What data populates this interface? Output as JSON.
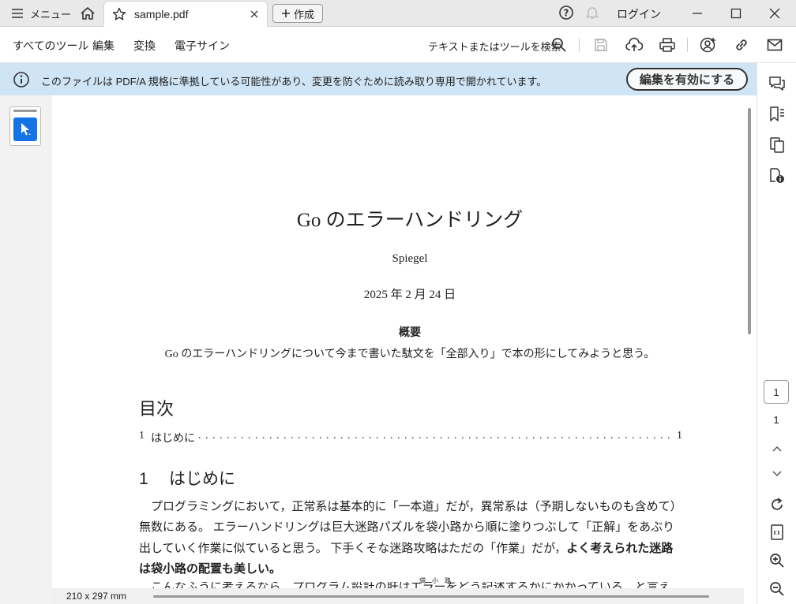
{
  "titlebar": {
    "menu_label": "メニュー",
    "tab_title": "sample.pdf",
    "create_label": "作成",
    "login_label": "ログイン"
  },
  "toolbar": {
    "menus": [
      "すべてのツール",
      "編集",
      "変換",
      "電子サイン"
    ],
    "search_label": "テキストまたはツールを検索"
  },
  "banner": {
    "text": "このファイルは PDF/A 規格に準拠している可能性があり、変更を防ぐために読み取り専用で開かれています。",
    "button_label": "編集を有効にする"
  },
  "document": {
    "title": "Go のエラーハンドリング",
    "author": "Spiegel",
    "date": "2025 年 2 月 24 日",
    "abstract_title": "概要",
    "abstract_text": "Go のエラーハンドリングについて今まで書いた駄文を「全部入り」で本の形にしてみようと思う。",
    "toc_title": "目次",
    "toc": [
      {
        "num": "1",
        "title": "はじめに",
        "page": "1"
      }
    ],
    "section": {
      "num": "1",
      "title": "はじめに"
    },
    "body_lines": [
      "　プログラミングにおいて，正常系は基本的に「一本道」だが，異常系は（予期しないものも含めて）",
      "無数にある。 エラーハンドリングは巨大迷路パズルを袋小路から順に塗りつぶして「正解」をあぶり",
      "出していく作業に似ていると思う。 下手くそな迷路攻略はただの「作業」だが，"
    ],
    "body_bold_a": "よく考えられた迷路",
    "body_bold_b": "は袋小路の配置も美しい。",
    "cut_text": "　こんなふうに考えるなら，プログラム設計の肝はエラーをどう記述するかにかかっている，と言え",
    "ruby": "袋　小　路"
  },
  "statusbar": {
    "page_size": "210 x 297 mm"
  },
  "pagination": {
    "current": "1",
    "total": "1"
  },
  "colors": {
    "banner": "#cfe4f5",
    "accent": "#1473e6"
  }
}
